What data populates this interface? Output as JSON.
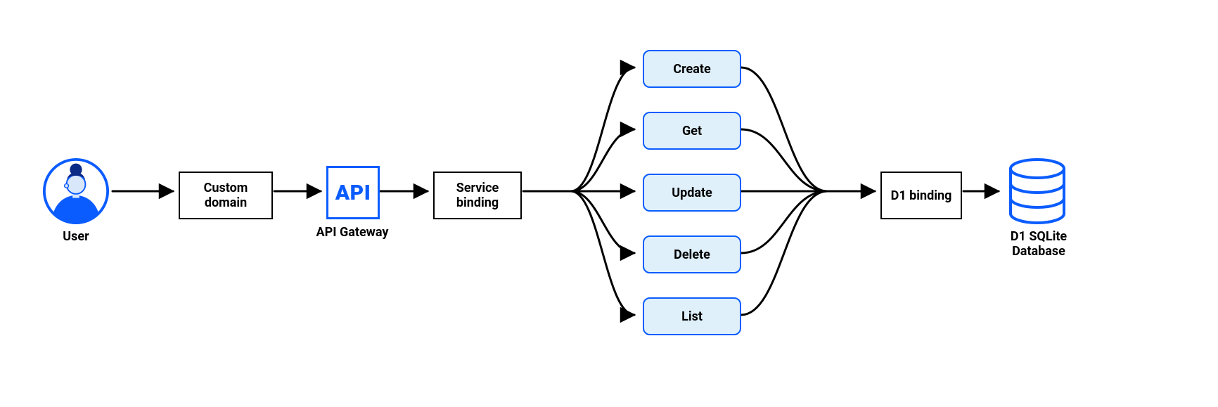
{
  "colors": {
    "blue": "#0b5cff",
    "blue_fill": "#dff0fa",
    "ink": "#000000"
  },
  "user": {
    "label": "User"
  },
  "custom_domain": {
    "label": "Custom\ndomain"
  },
  "api_gateway": {
    "box_text": "API",
    "label": "API Gateway"
  },
  "service_binding": {
    "label": "Service\nbinding"
  },
  "operations": [
    {
      "label": "Create"
    },
    {
      "label": "Get"
    },
    {
      "label": "Update"
    },
    {
      "label": "Delete"
    },
    {
      "label": "List"
    }
  ],
  "d1_binding": {
    "label": "D1\nbinding"
  },
  "database": {
    "label": "D1 SQLite\nDatabase"
  }
}
